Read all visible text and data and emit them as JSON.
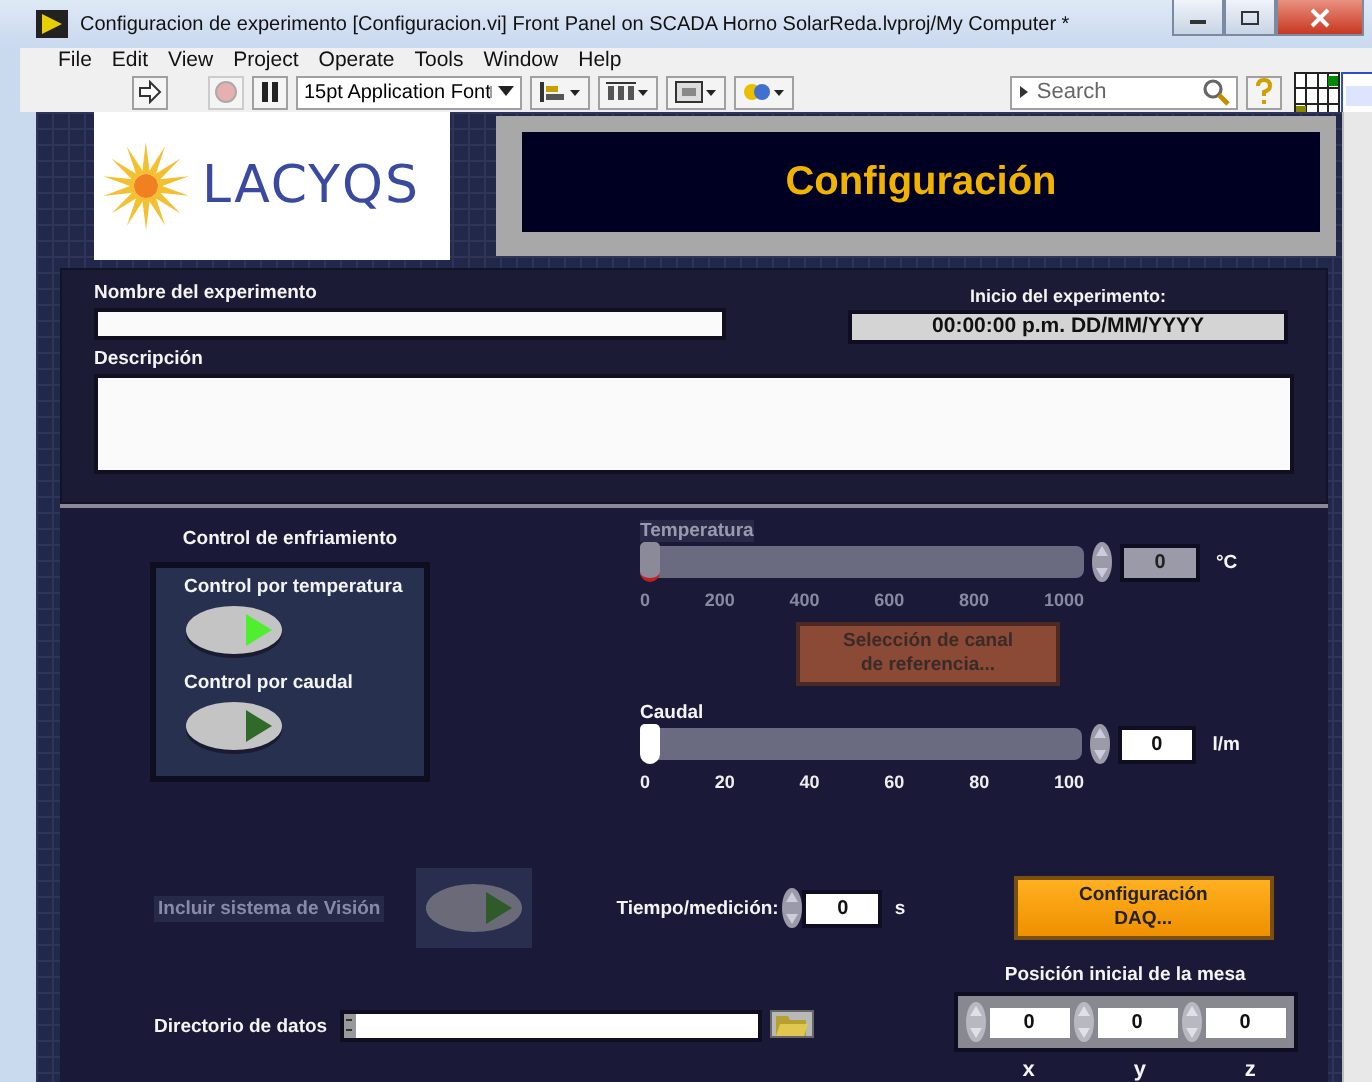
{
  "window": {
    "title": "Configuracion de experimento [Configuracion.vi] Front Panel on SCADA Horno SolarReda.lvproj/My Computer *"
  },
  "menu": [
    "File",
    "Edit",
    "View",
    "Project",
    "Operate",
    "Tools",
    "Window",
    "Help"
  ],
  "toolbar": {
    "font": "15pt Application Font",
    "search_placeholder": "Search"
  },
  "logo": {
    "text": "LACYQS"
  },
  "header": {
    "title": "Configuración"
  },
  "experiment": {
    "name_label": "Nombre del experimento",
    "start_label": "Inicio del experimento:",
    "start_value": "00:00:00 p.m. DD/MM/YYYY",
    "description_label": "Descripción"
  },
  "cooling": {
    "title": "Control de enfriamiento",
    "options": [
      {
        "label": "Control por temperatura",
        "on": true
      },
      {
        "label": "Control por caudal",
        "on": false
      }
    ]
  },
  "sliders": [
    {
      "label": "Temperatura",
      "disabled": true,
      "level": 0,
      "value": "0",
      "unit": "°C",
      "ticks": [
        "0",
        "200",
        "400",
        "600",
        "800",
        "1000"
      ]
    },
    {
      "label": "Caudal",
      "disabled": false,
      "level": 0,
      "value": "0",
      "unit": "l/m",
      "ticks": [
        "0",
        "20",
        "40",
        "60",
        "80",
        "100"
      ]
    }
  ],
  "channel_button": {
    "label": "Selección de canal\nde referencia...",
    "disabled": true
  },
  "vision": {
    "label": "Incluir sistema de Visión",
    "disabled": true,
    "on": false
  },
  "time": {
    "label": "Tiempo/medición:",
    "value": "0",
    "unit": "s"
  },
  "daq_button": {
    "label": "Configuración\nDAQ..."
  },
  "directory": {
    "label": "Directorio de datos"
  },
  "position": {
    "title": "Posición inicial de la mesa",
    "axes": [
      {
        "label": "x",
        "value": "0"
      },
      {
        "label": "y",
        "value": "0"
      },
      {
        "label": "z",
        "value": "0"
      }
    ]
  }
}
